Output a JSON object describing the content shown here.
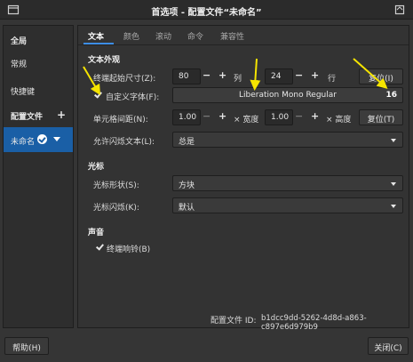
{
  "window": {
    "title": "首选项 - 配置文件“未命名”"
  },
  "sidebar": {
    "items": [
      {
        "label": "全局"
      },
      {
        "label": "常规"
      },
      {
        "label": "快捷键"
      },
      {
        "label": "配置文件",
        "add": "+"
      },
      {
        "label": "未命名"
      }
    ]
  },
  "tabs": [
    {
      "label": "文本"
    },
    {
      "label": "颜色"
    },
    {
      "label": "滚动"
    },
    {
      "label": "命令"
    },
    {
      "label": "兼容性"
    }
  ],
  "text_appearance": {
    "section": "文本外观",
    "initial_size_label": "终端起始尺寸(Z):",
    "columns_value": "80",
    "columns_unit": "列",
    "rows_value": "24",
    "rows_unit": "行",
    "reset_label": "复位(I)",
    "custom_font_label": "自定义字体(F):",
    "custom_font_checked": true,
    "font_name": "Liberation Mono Regular",
    "font_size": "16",
    "cell_spacing_label": "单元格间距(N):",
    "width_value": "1.00",
    "width_unit": "× 宽度",
    "height_value": "1.00",
    "height_unit": "× 高度",
    "spacing_reset_label": "复位(T)",
    "blink_label": "允许闪烁文本(L):",
    "blink_value": "总是",
    "minus": "−",
    "plus": "+"
  },
  "cursor": {
    "section": "光标",
    "shape_label": "光标形状(S):",
    "shape_value": "方块",
    "blink_label": "光标闪烁(K):",
    "blink_value": "默认"
  },
  "sound": {
    "section": "声音",
    "bell_label": "终端响铃(B)",
    "bell_checked": true
  },
  "profile_id": {
    "label": "配置文件 ID:",
    "value": "b1dcc9dd-5262-4d8d-a863-c897e6d979b9"
  },
  "footer": {
    "help_label": "帮助(H)",
    "close_label": "关闭(C)"
  },
  "colors": {
    "accent": "#1a5fa6",
    "tab_underline": "#3d8ee6",
    "annotation_arrow": "#f5e400"
  }
}
